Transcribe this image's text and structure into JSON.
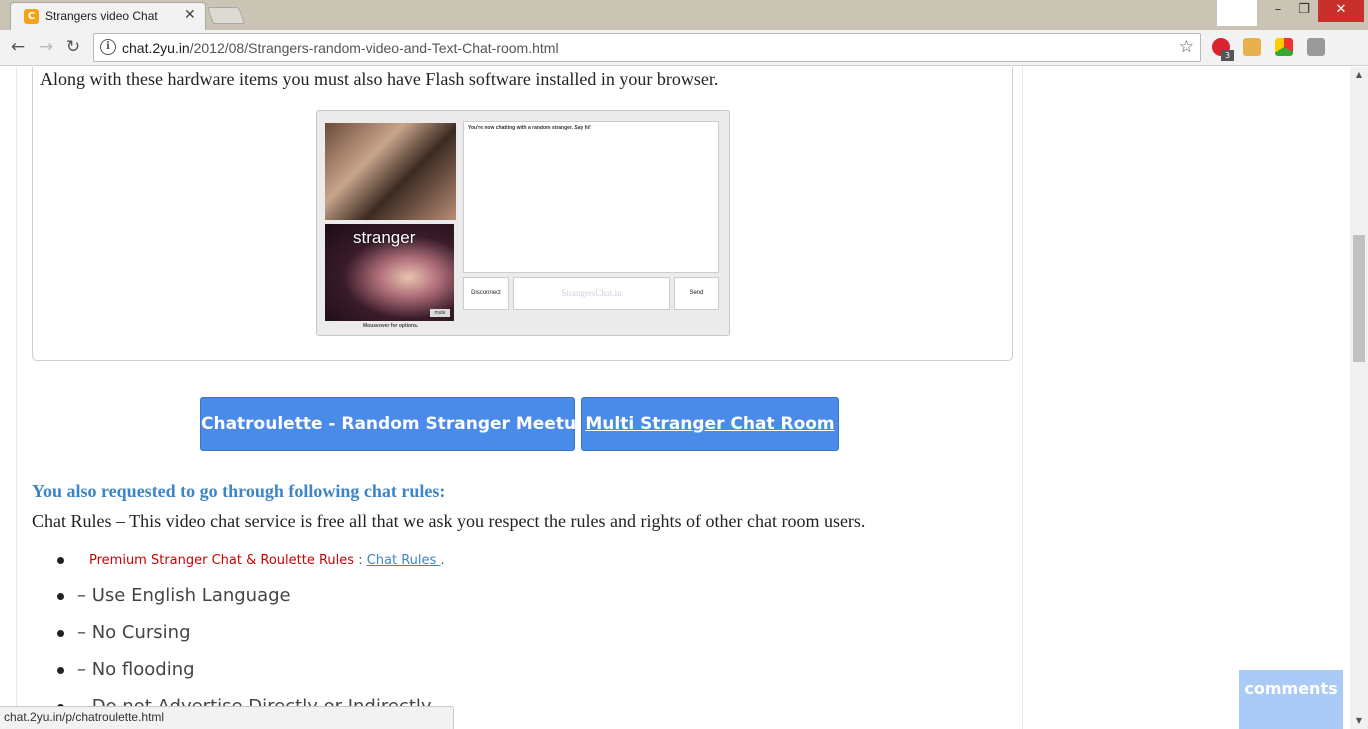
{
  "browser": {
    "tab_title": "Strangers video Chat",
    "tab_close": "✕",
    "favicon_letter": "C",
    "url_host": "chat.2yu.in",
    "url_path": "/2012/08/Strangers-random-video-and-Text-Chat-room.html",
    "extension_badge": "3",
    "status_url": "chat.2yu.in/p/chatroulette.html"
  },
  "article": {
    "flash_paragraph": "Along with these hardware items you must also have Flash software installed in your browser.",
    "screenshot": {
      "cam_label": "stranger",
      "mute_label": "mute",
      "mouseover_hint": "Mouseover for options.",
      "chat_log_text": "You're now chatting with a random stranger. Say hi!",
      "disconnect_label": "Disconnect",
      "input_watermark": "StrangersChat.in",
      "send_label": "Send"
    },
    "buttons": {
      "chatroulette": "Chatroulette - Random Stranger Meetup",
      "multi_room": "Multi Stranger Chat Room"
    },
    "rules_heading": "You also requested to go through following chat rules:",
    "rules_intro": "Chat Rules – This video chat service is free all that we ask you respect the rules and rights of other chat room users.",
    "premium_rules": {
      "label": "Premium Stranger Chat & Roulette Rules",
      "separator": ":",
      "link": "Chat Rules ",
      "suffix": "."
    },
    "rules": [
      "– Use English Language",
      "– No Cursing",
      "– No flooding",
      "– Do not Advertise Directly or Indirectly"
    ]
  },
  "comments_button": "comments",
  "colors": {
    "cta": "#4a8ae8",
    "heading": "#3d85c6",
    "premium_text": "#cc0000",
    "comments": "#a9cbf5"
  }
}
